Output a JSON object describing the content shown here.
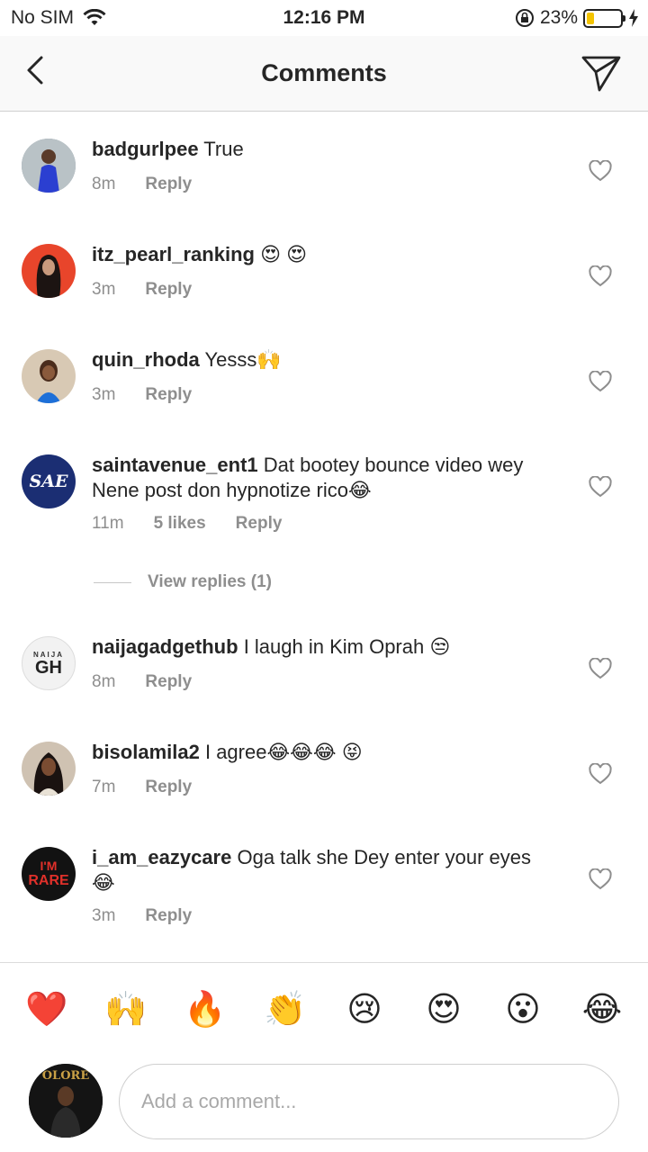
{
  "status_bar": {
    "carrier": "No SIM",
    "time": "12:16 PM",
    "battery_percent": "23%",
    "battery_level": 0.23
  },
  "header": {
    "title": "Comments"
  },
  "comments": [
    {
      "username": "badgurlpee",
      "text": "True",
      "time": "8m",
      "likes": "",
      "reply": "Reply"
    },
    {
      "username": "itz_pearl_ranking",
      "text": "😍 😍",
      "time": "3m",
      "likes": "",
      "reply": "Reply"
    },
    {
      "username": "quin_rhoda",
      "text": "Yesss🙌",
      "time": "3m",
      "likes": "",
      "reply": "Reply"
    },
    {
      "username": "saintavenue_ent1",
      "text": "Dat bootey bounce video wey Nene post don hypnotize rico😂",
      "time": "11m",
      "likes": "5 likes",
      "reply": "Reply"
    },
    {
      "username": "naijagadgethub",
      "text": "I laugh in Kim Oprah 😒",
      "time": "8m",
      "likes": "",
      "reply": "Reply"
    },
    {
      "username": "bisolamila2",
      "text": "I agree😂😂😂 😝",
      "time": "7m",
      "likes": "",
      "reply": "Reply"
    },
    {
      "username": "i_am_eazycare",
      "text": "Oga talk she Dey enter your eyes 😂",
      "time": "3m",
      "likes": "",
      "reply": "Reply"
    }
  ],
  "view_replies": "View replies (1)",
  "avatar_texts": {
    "saintavenue": "SAE",
    "naija": "GH",
    "naija_top": "NAIJA",
    "eazy1": "I'M",
    "eazy2": "RARE",
    "me": "OLORE"
  },
  "quick_emojis": [
    "❤️",
    "🙌",
    "🔥",
    "👏",
    "😢",
    "😍",
    "😮",
    "😂"
  ],
  "input": {
    "placeholder": "Add a comment..."
  },
  "colors": {
    "text": "#262626",
    "secondary": "#8e8e8e",
    "battery": "#f4c400"
  }
}
